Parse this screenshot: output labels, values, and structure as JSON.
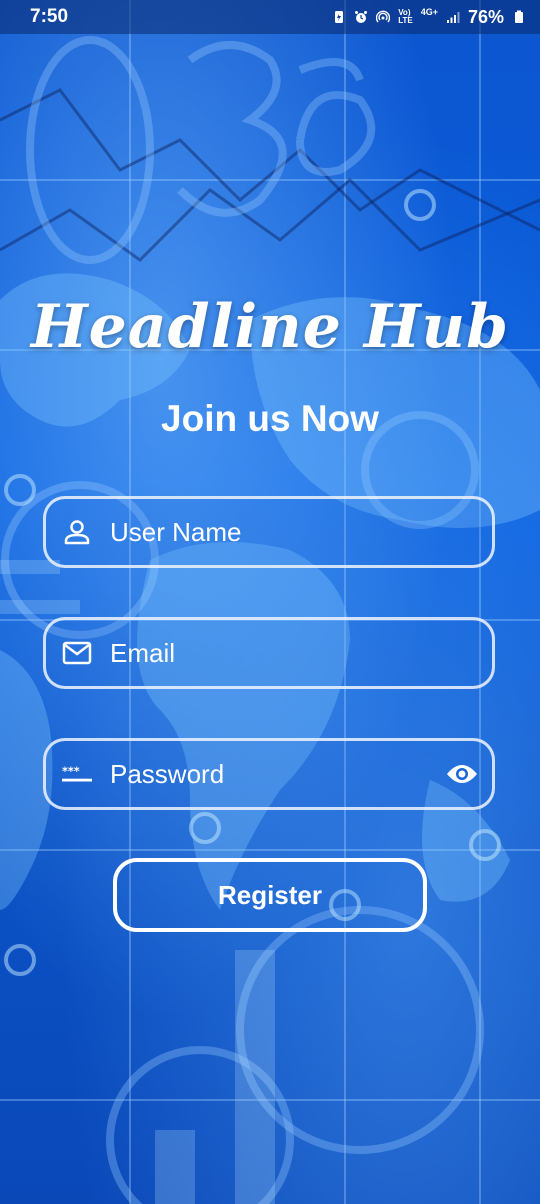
{
  "status_bar": {
    "time": "7:50",
    "network_label_top": "Vo)",
    "network_label_bottom": "LTE",
    "network_gen": "4G+",
    "battery": "76%"
  },
  "app": {
    "title": "Headline Hub",
    "subtitle": "Join us Now"
  },
  "form": {
    "username_placeholder": "User Name",
    "email_placeholder": "Email",
    "password_placeholder": "Password",
    "register_label": "Register"
  },
  "icons": {
    "username": "person-icon",
    "email": "mail-icon",
    "password": "password-dots-icon",
    "visibility": "eye-icon"
  },
  "colors": {
    "background": "#0a52c9",
    "text": "#ffffff",
    "field_border": "#f0f5ff"
  }
}
